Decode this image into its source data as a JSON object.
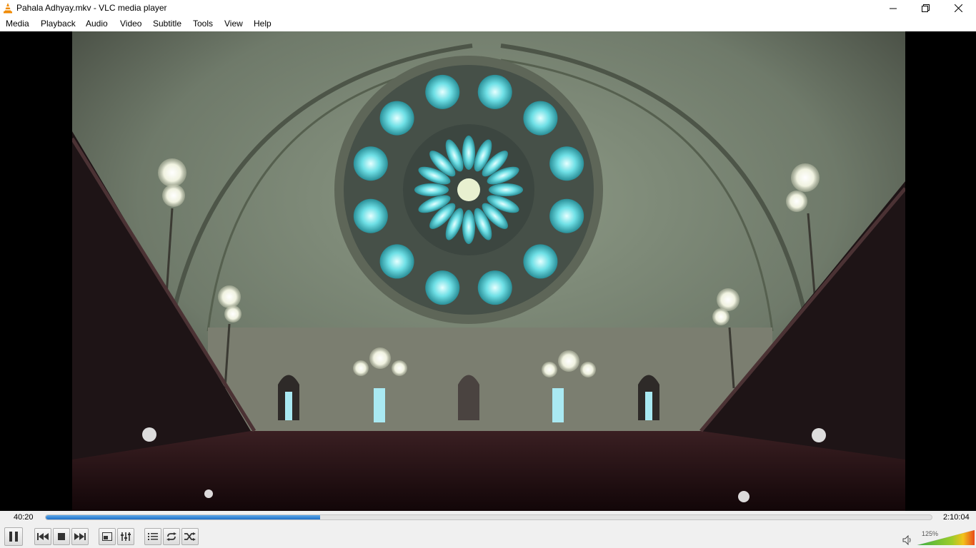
{
  "window": {
    "title": "Pahala Adhyay.mkv - VLC media player"
  },
  "menu": [
    {
      "label": "Media"
    },
    {
      "label": "Playback"
    },
    {
      "label": "Audio"
    },
    {
      "label": "Video"
    },
    {
      "label": "Subtitle"
    },
    {
      "label": "Tools"
    },
    {
      "label": "View"
    },
    {
      "label": "Help"
    }
  ],
  "playback": {
    "elapsed": "40:20",
    "total": "2:10:04",
    "progress_fraction": 0.31
  },
  "volume": {
    "label": "125%",
    "level_percent": 125
  },
  "icons": {
    "app": "vlc-cone-icon",
    "minimize": "minimize-icon",
    "maximize": "restore-icon",
    "close": "close-icon",
    "pause": "pause-icon",
    "previous": "previous-icon",
    "stop": "stop-icon",
    "next": "next-icon",
    "fullscreen": "fullscreen-icon",
    "extended": "extended-settings-icon",
    "playlist": "playlist-icon",
    "loop": "loop-icon",
    "random": "shuffle-icon",
    "speaker": "speaker-icon"
  },
  "colors": {
    "accent": "#1d6fc8",
    "volume_low": "#3cb043",
    "volume_high": "#e84a1c"
  }
}
